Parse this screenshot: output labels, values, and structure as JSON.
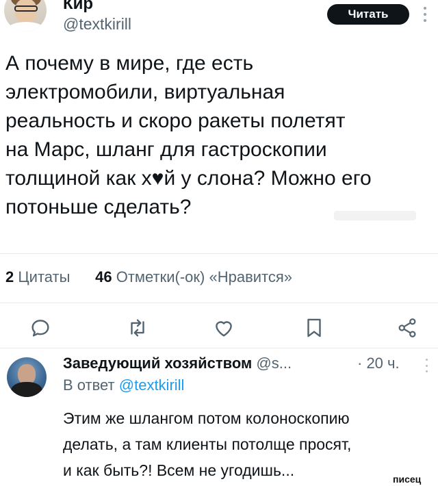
{
  "post": {
    "author_name": "Кир",
    "author_handle": "@textkirill",
    "follow_label": "Читать",
    "text_lines": [
      "А почему в мире, где есть",
      "электромобили, виртуальная",
      "реальность и скоро ракеты полетят",
      "на Марс, шланг для гастроскопии",
      "толщиной как х♥й у слона? Можно его",
      "потоньше сделать?"
    ],
    "stats": {
      "quotes_count": "2",
      "quotes_label": "Цитаты",
      "likes_count": "46",
      "likes_label": "Отметки(-ок) «Нравится»"
    }
  },
  "actions": [
    {
      "name": "reply",
      "icon": "comment-icon"
    },
    {
      "name": "repost",
      "icon": "repost-icon"
    },
    {
      "name": "like",
      "icon": "heart-icon"
    },
    {
      "name": "bookmark",
      "icon": "bookmark-icon"
    },
    {
      "name": "share",
      "icon": "share-icon"
    }
  ],
  "reply": {
    "author_name": "Заведующий хозяйством",
    "author_handle": "@s...",
    "time": "· 20 ч.",
    "replying_to_label": "В ответ",
    "replying_to_handle": "@textkirill",
    "text_lines": [
      "Этим же шлангом потом колоноскопию",
      "делать, а там клиенты потолще просят,",
      "и как быть?! Всем не угодишь..."
    ]
  },
  "watermark": "писец",
  "colors": {
    "text": "#0f1419",
    "secondary": "#536471",
    "link": "#1d9bf0",
    "button_bg": "#0f1419",
    "button_text": "#ffffff"
  }
}
